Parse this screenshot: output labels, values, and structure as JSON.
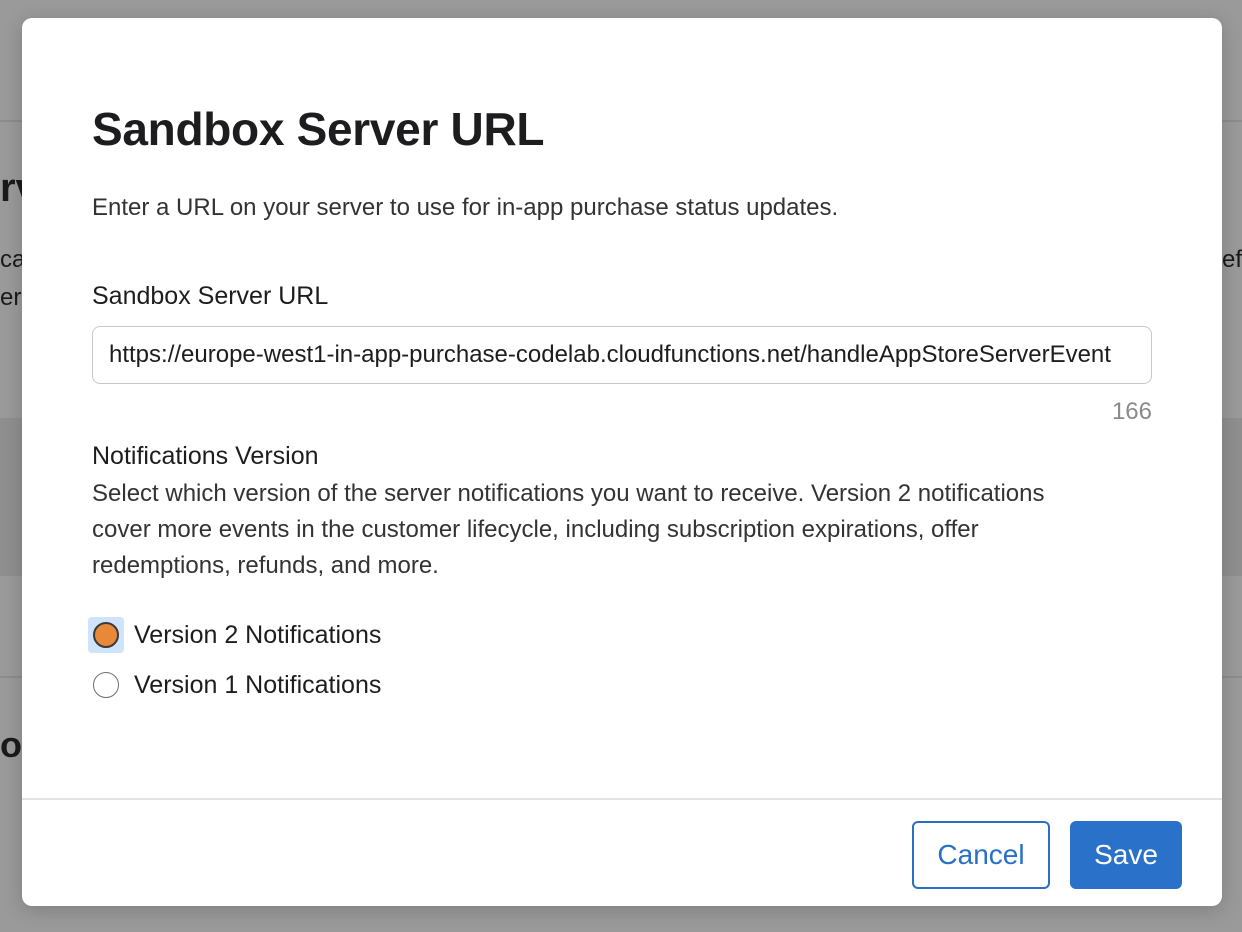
{
  "modal": {
    "title": "Sandbox Server URL",
    "description": "Enter a URL on your server to use for in-app purchase status updates."
  },
  "url_field": {
    "label": "Sandbox Server URL",
    "value": "https://europe-west1-in-app-purchase-codelab.cloudfunctions.net/handleAppStoreServerEvent",
    "char_count": "166"
  },
  "notifications": {
    "label": "Notifications Version",
    "description": "Select which version of the server notifications you want to receive. Version 2 notifications cover more events in the customer lifecycle, including subscription expirations, offer redemptions, refunds, and more.",
    "options": [
      {
        "label": "Version 2 Notifications",
        "checked": true
      },
      {
        "label": "Version 1 Notifications",
        "checked": false
      }
    ]
  },
  "footer": {
    "cancel_label": "Cancel",
    "save_label": "Save"
  },
  "colors": {
    "accent": "#2a71c9",
    "radio_selected": "#e8893a",
    "focus_ring": "#cfe3fb",
    "backdrop": "#9a9a9a"
  }
}
